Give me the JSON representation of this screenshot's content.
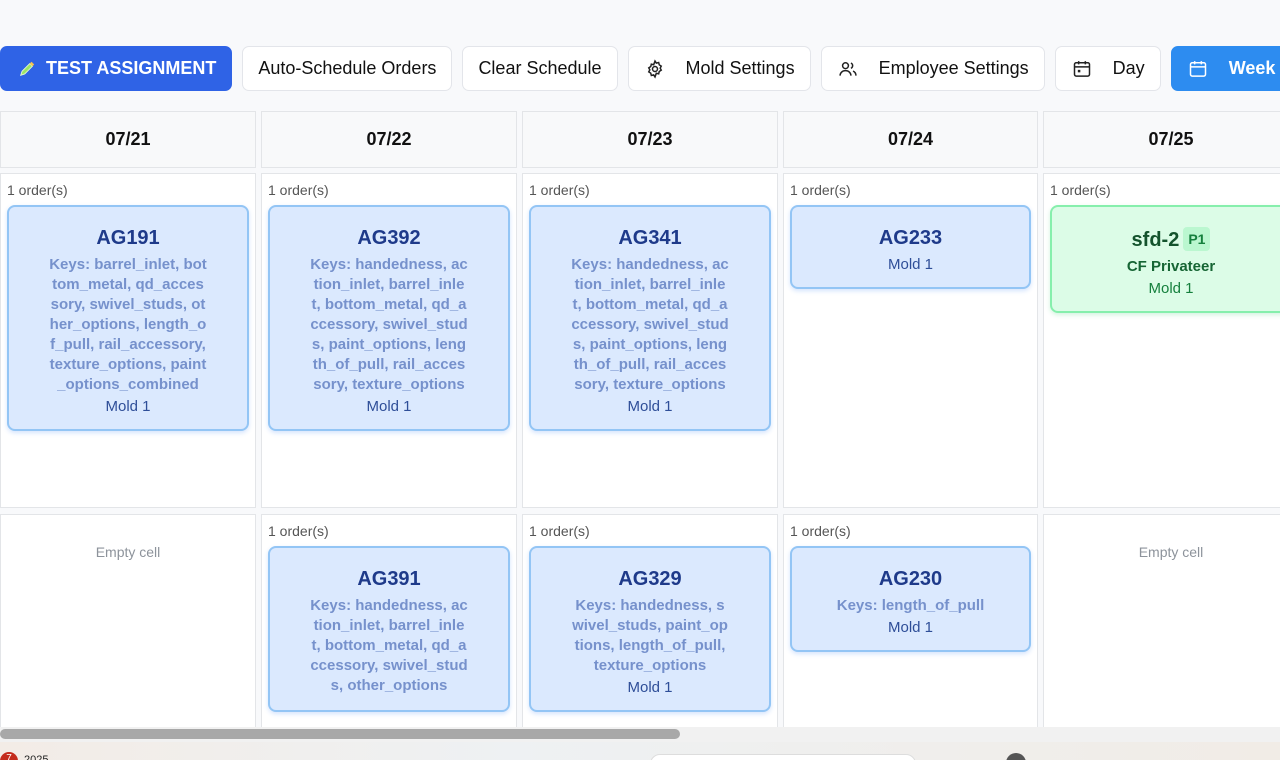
{
  "toolbar": {
    "test_assignment": "TEST ASSIGNMENT",
    "auto_schedule": "Auto-Schedule Orders",
    "clear_schedule": "Clear Schedule",
    "mold_settings": "Mold Settings",
    "employee_settings": "Employee Settings",
    "day": "Day",
    "week": "Week",
    "active_view": "Week"
  },
  "days": [
    "07/21",
    "07/22",
    "07/23",
    "07/24",
    "07/25"
  ],
  "rows": [
    {
      "cells": [
        {
          "count": "1 order(s)",
          "card": {
            "code": "AG191",
            "keys": "Keys: barrel_inlet, bottom_metal, qd_accessory, swivel_studs, other_options, length_of_pull, rail_accessory, texture_options, paint_options_combined",
            "mold": "Mold 1"
          }
        },
        {
          "count": "1 order(s)",
          "card": {
            "code": "AG392",
            "keys": "Keys: handedness, action_inlet, barrel_inlet, bottom_metal, qd_accessory, swivel_studs, paint_options, length_of_pull, rail_accessory, texture_options",
            "mold": "Mold 1"
          }
        },
        {
          "count": "1 order(s)",
          "card": {
            "code": "AG341",
            "keys": "Keys: handedness, action_inlet, barrel_inlet, bottom_metal, qd_accessory, swivel_studs, paint_options, length_of_pull, rail_accessory, texture_options",
            "mold": "Mold 1"
          }
        },
        {
          "count": "1 order(s)",
          "card": {
            "code": "AG233",
            "mold": "Mold 1"
          }
        },
        {
          "count": "1 order(s)",
          "card": {
            "code": "sfd-2",
            "badge": "P1",
            "customer": "CF Privateer",
            "mold": "Mold 1",
            "color": "green"
          }
        }
      ]
    },
    {
      "cells": [
        {
          "empty": "Empty cell"
        },
        {
          "count": "1 order(s)",
          "card": {
            "code": "AG391",
            "keys": "Keys: handedness, action_inlet, barrel_inlet, bottom_metal, qd_accessory, swivel_studs, other_options",
            "mold": ""
          }
        },
        {
          "count": "1 order(s)",
          "card": {
            "code": "AG329",
            "keys": "Keys: handedness, swivel_studs, paint_options, length_of_pull, texture_options",
            "mold": "Mold 1"
          }
        },
        {
          "count": "1 order(s)",
          "card": {
            "code": "AG230",
            "keys": "Keys: length_of_pull",
            "mold": "Mold 1"
          }
        },
        {
          "empty": "Empty cell"
        }
      ]
    }
  ],
  "taskbar": {
    "badge": "7",
    "text": "2025"
  },
  "colors": {
    "primary": "#2f63e6",
    "active": "#2d8cf0",
    "card_blue": "#dbe9fe",
    "card_green": "#dcfce7"
  }
}
